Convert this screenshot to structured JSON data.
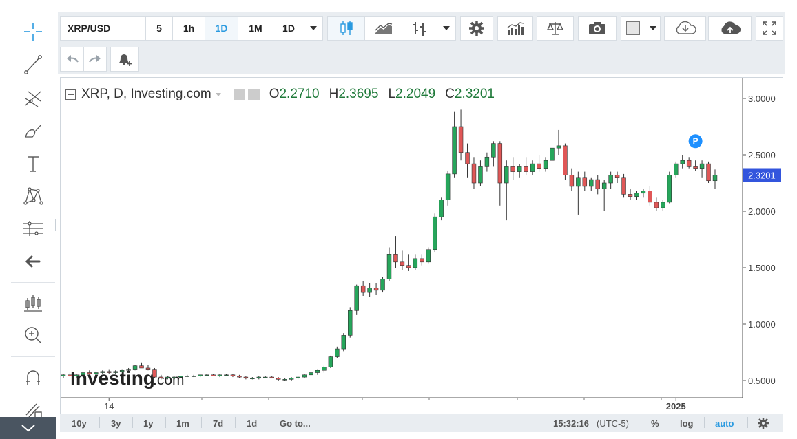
{
  "toolbar": {
    "symbol": "XRP/USD",
    "intervals": [
      "5",
      "1h",
      "1D",
      "1M",
      "1D"
    ],
    "selected_interval": "1D"
  },
  "legend": {
    "title": "XRP, D, Investing.com",
    "open_label": "O",
    "open": "2.2710",
    "high_label": "H",
    "high": "2.3695",
    "low_label": "L",
    "low": "2.2049",
    "close_label": "C",
    "close": "2.3201"
  },
  "price_marker": "2.3201",
  "marker_badge": "P",
  "watermark": {
    "brand": "Investing",
    "suffix": ".com"
  },
  "bottom_bar": {
    "ranges": [
      "10y",
      "3y",
      "1y",
      "1m",
      "7d",
      "1d"
    ],
    "goto": "Go to...",
    "clock": "15:32:16",
    "timezone": "(UTC-5)",
    "percent": "%",
    "log": "log",
    "auto": "auto"
  },
  "colors": {
    "up": "#26a65b",
    "down": "#e05757",
    "accent": "#2a9ae0",
    "price_line": "#4a64d8"
  },
  "chart_data": {
    "type": "candlestick",
    "y_ticks": [
      "3.0000",
      "2.5000",
      "2.0000",
      "1.5000",
      "1.0000",
      "0.5000"
    ],
    "x_ticks": [
      "14",
      "2025"
    ],
    "ylim": [
      0.35,
      3.2
    ],
    "last_price": 2.3201,
    "candles": [
      {
        "o": 0.54,
        "h": 0.56,
        "l": 0.52,
        "c": 0.55
      },
      {
        "o": 0.55,
        "h": 0.57,
        "l": 0.53,
        "c": 0.54
      },
      {
        "o": 0.54,
        "h": 0.56,
        "l": 0.52,
        "c": 0.55
      },
      {
        "o": 0.55,
        "h": 0.58,
        "l": 0.54,
        "c": 0.57
      },
      {
        "o": 0.57,
        "h": 0.59,
        "l": 0.55,
        "c": 0.56
      },
      {
        "o": 0.56,
        "h": 0.58,
        "l": 0.55,
        "c": 0.57
      },
      {
        "o": 0.57,
        "h": 0.59,
        "l": 0.56,
        "c": 0.58
      },
      {
        "o": 0.58,
        "h": 0.6,
        "l": 0.56,
        "c": 0.57
      },
      {
        "o": 0.57,
        "h": 0.59,
        "l": 0.56,
        "c": 0.58
      },
      {
        "o": 0.58,
        "h": 0.6,
        "l": 0.57,
        "c": 0.59
      },
      {
        "o": 0.59,
        "h": 0.61,
        "l": 0.58,
        "c": 0.6
      },
      {
        "o": 0.6,
        "h": 0.64,
        "l": 0.59,
        "c": 0.63
      },
      {
        "o": 0.63,
        "h": 0.66,
        "l": 0.61,
        "c": 0.61
      },
      {
        "o": 0.61,
        "h": 0.64,
        "l": 0.59,
        "c": 0.6
      },
      {
        "o": 0.6,
        "h": 0.61,
        "l": 0.52,
        "c": 0.53
      },
      {
        "o": 0.53,
        "h": 0.55,
        "l": 0.51,
        "c": 0.52
      },
      {
        "o": 0.52,
        "h": 0.54,
        "l": 0.51,
        "c": 0.53
      },
      {
        "o": 0.53,
        "h": 0.54,
        "l": 0.52,
        "c": 0.53
      },
      {
        "o": 0.53,
        "h": 0.54,
        "l": 0.52,
        "c": 0.54
      },
      {
        "o": 0.54,
        "h": 0.55,
        "l": 0.53,
        "c": 0.54
      },
      {
        "o": 0.54,
        "h": 0.55,
        "l": 0.53,
        "c": 0.54
      },
      {
        "o": 0.54,
        "h": 0.55,
        "l": 0.53,
        "c": 0.55
      },
      {
        "o": 0.55,
        "h": 0.56,
        "l": 0.54,
        "c": 0.55
      },
      {
        "o": 0.55,
        "h": 0.56,
        "l": 0.54,
        "c": 0.54
      },
      {
        "o": 0.54,
        "h": 0.56,
        "l": 0.53,
        "c": 0.55
      },
      {
        "o": 0.55,
        "h": 0.56,
        "l": 0.54,
        "c": 0.55
      },
      {
        "o": 0.55,
        "h": 0.56,
        "l": 0.53,
        "c": 0.54
      },
      {
        "o": 0.54,
        "h": 0.55,
        "l": 0.52,
        "c": 0.53
      },
      {
        "o": 0.53,
        "h": 0.54,
        "l": 0.51,
        "c": 0.52
      },
      {
        "o": 0.52,
        "h": 0.53,
        "l": 0.51,
        "c": 0.52
      },
      {
        "o": 0.52,
        "h": 0.54,
        "l": 0.51,
        "c": 0.53
      },
      {
        "o": 0.53,
        "h": 0.54,
        "l": 0.52,
        "c": 0.53
      },
      {
        "o": 0.53,
        "h": 0.54,
        "l": 0.52,
        "c": 0.52
      },
      {
        "o": 0.52,
        "h": 0.53,
        "l": 0.5,
        "c": 0.51
      },
      {
        "o": 0.51,
        "h": 0.52,
        "l": 0.5,
        "c": 0.51
      },
      {
        "o": 0.51,
        "h": 0.53,
        "l": 0.5,
        "c": 0.52
      },
      {
        "o": 0.52,
        "h": 0.54,
        "l": 0.51,
        "c": 0.53
      },
      {
        "o": 0.53,
        "h": 0.56,
        "l": 0.52,
        "c": 0.55
      },
      {
        "o": 0.55,
        "h": 0.58,
        "l": 0.54,
        "c": 0.57
      },
      {
        "o": 0.57,
        "h": 0.6,
        "l": 0.55,
        "c": 0.59
      },
      {
        "o": 0.59,
        "h": 0.63,
        "l": 0.57,
        "c": 0.62
      },
      {
        "o": 0.62,
        "h": 0.72,
        "l": 0.61,
        "c": 0.71
      },
      {
        "o": 0.71,
        "h": 0.8,
        "l": 0.7,
        "c": 0.78
      },
      {
        "o": 0.78,
        "h": 0.92,
        "l": 0.76,
        "c": 0.9
      },
      {
        "o": 0.9,
        "h": 1.15,
        "l": 0.88,
        "c": 1.12
      },
      {
        "o": 1.12,
        "h": 1.35,
        "l": 1.08,
        "c": 1.34
      },
      {
        "o": 1.34,
        "h": 1.38,
        "l": 1.25,
        "c": 1.28
      },
      {
        "o": 1.28,
        "h": 1.36,
        "l": 1.24,
        "c": 1.32
      },
      {
        "o": 1.32,
        "h": 1.36,
        "l": 1.26,
        "c": 1.3
      },
      {
        "o": 1.3,
        "h": 1.42,
        "l": 1.28,
        "c": 1.4
      },
      {
        "o": 1.4,
        "h": 1.68,
        "l": 1.38,
        "c": 1.62
      },
      {
        "o": 1.62,
        "h": 1.78,
        "l": 1.5,
        "c": 1.55
      },
      {
        "o": 1.55,
        "h": 1.65,
        "l": 1.48,
        "c": 1.52
      },
      {
        "o": 1.52,
        "h": 1.62,
        "l": 1.47,
        "c": 1.5
      },
      {
        "o": 1.5,
        "h": 1.62,
        "l": 1.48,
        "c": 1.58
      },
      {
        "o": 1.58,
        "h": 1.62,
        "l": 1.52,
        "c": 1.55
      },
      {
        "o": 1.55,
        "h": 1.68,
        "l": 1.54,
        "c": 1.66
      },
      {
        "o": 1.66,
        "h": 1.98,
        "l": 1.64,
        "c": 1.95
      },
      {
        "o": 1.95,
        "h": 2.12,
        "l": 1.92,
        "c": 2.1
      },
      {
        "o": 2.1,
        "h": 2.36,
        "l": 2.05,
        "c": 2.33
      },
      {
        "o": 2.33,
        "h": 2.88,
        "l": 2.3,
        "c": 2.75
      },
      {
        "o": 2.75,
        "h": 2.9,
        "l": 2.45,
        "c": 2.52
      },
      {
        "o": 2.52,
        "h": 2.6,
        "l": 2.3,
        "c": 2.42
      },
      {
        "o": 2.42,
        "h": 2.48,
        "l": 2.2,
        "c": 2.25
      },
      {
        "o": 2.25,
        "h": 2.45,
        "l": 2.22,
        "c": 2.4
      },
      {
        "o": 2.4,
        "h": 2.52,
        "l": 2.35,
        "c": 2.48
      },
      {
        "o": 2.48,
        "h": 2.62,
        "l": 2.4,
        "c": 2.6
      },
      {
        "o": 2.6,
        "h": 2.62,
        "l": 2.05,
        "c": 2.25
      },
      {
        "o": 2.25,
        "h": 2.45,
        "l": 1.92,
        "c": 2.4
      },
      {
        "o": 2.4,
        "h": 2.48,
        "l": 2.28,
        "c": 2.35
      },
      {
        "o": 2.35,
        "h": 2.42,
        "l": 2.3,
        "c": 2.4
      },
      {
        "o": 2.4,
        "h": 2.48,
        "l": 2.32,
        "c": 2.35
      },
      {
        "o": 2.35,
        "h": 2.45,
        "l": 2.32,
        "c": 2.42
      },
      {
        "o": 2.42,
        "h": 2.5,
        "l": 2.35,
        "c": 2.38
      },
      {
        "o": 2.38,
        "h": 2.48,
        "l": 2.35,
        "c": 2.45
      },
      {
        "o": 2.45,
        "h": 2.58,
        "l": 2.4,
        "c": 2.56
      },
      {
        "o": 2.56,
        "h": 2.72,
        "l": 2.5,
        "c": 2.58
      },
      {
        "o": 2.58,
        "h": 2.6,
        "l": 2.28,
        "c": 2.32
      },
      {
        "o": 2.32,
        "h": 2.38,
        "l": 2.18,
        "c": 2.22
      },
      {
        "o": 2.22,
        "h": 2.35,
        "l": 1.97,
        "c": 2.3
      },
      {
        "o": 2.3,
        "h": 2.35,
        "l": 2.18,
        "c": 2.22
      },
      {
        "o": 2.22,
        "h": 2.3,
        "l": 2.18,
        "c": 2.28
      },
      {
        "o": 2.28,
        "h": 2.32,
        "l": 2.15,
        "c": 2.2
      },
      {
        "o": 2.2,
        "h": 2.28,
        "l": 2.0,
        "c": 2.25
      },
      {
        "o": 2.25,
        "h": 2.35,
        "l": 2.2,
        "c": 2.32
      },
      {
        "o": 2.32,
        "h": 2.35,
        "l": 2.25,
        "c": 2.3
      },
      {
        "o": 2.3,
        "h": 2.33,
        "l": 2.12,
        "c": 2.15
      },
      {
        "o": 2.15,
        "h": 2.2,
        "l": 2.1,
        "c": 2.13
      },
      {
        "o": 2.13,
        "h": 2.18,
        "l": 2.1,
        "c": 2.16
      },
      {
        "o": 2.16,
        "h": 2.2,
        "l": 2.12,
        "c": 2.18
      },
      {
        "o": 2.18,
        "h": 2.22,
        "l": 2.05,
        "c": 2.08
      },
      {
        "o": 2.08,
        "h": 2.12,
        "l": 2.0,
        "c": 2.03
      },
      {
        "o": 2.03,
        "h": 2.1,
        "l": 2.0,
        "c": 2.08
      },
      {
        "o": 2.08,
        "h": 2.35,
        "l": 2.07,
        "c": 2.32
      },
      {
        "o": 2.32,
        "h": 2.44,
        "l": 2.3,
        "c": 2.42
      },
      {
        "o": 2.42,
        "h": 2.5,
        "l": 2.38,
        "c": 2.45
      },
      {
        "o": 2.45,
        "h": 2.48,
        "l": 2.38,
        "c": 2.4
      },
      {
        "o": 2.4,
        "h": 2.45,
        "l": 2.36,
        "c": 2.38
      },
      {
        "o": 2.38,
        "h": 2.45,
        "l": 2.3,
        "c": 2.42
      },
      {
        "o": 2.42,
        "h": 2.44,
        "l": 2.25,
        "c": 2.27
      },
      {
        "o": 2.27,
        "h": 2.37,
        "l": 2.2,
        "c": 2.32
      }
    ]
  }
}
